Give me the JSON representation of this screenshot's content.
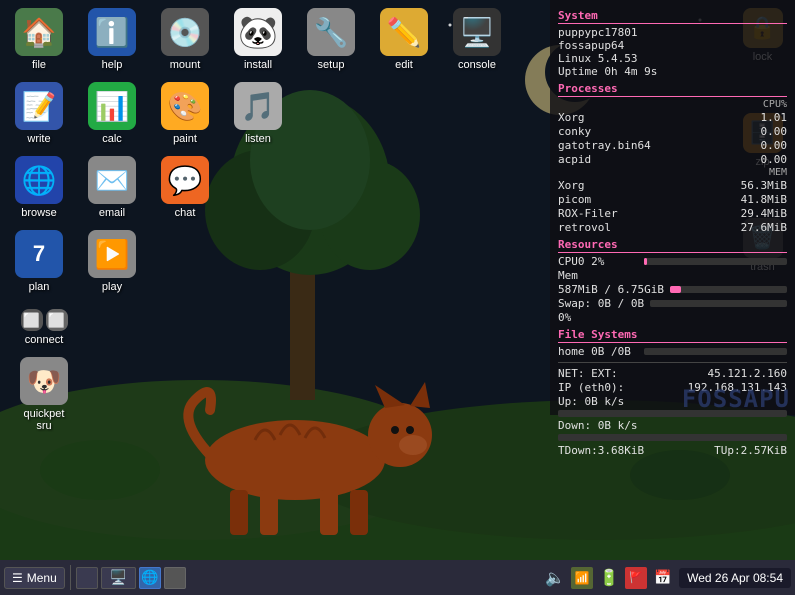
{
  "desktop": {
    "icons": [
      [
        {
          "id": "file",
          "label": "file",
          "emoji": "🏠",
          "color": "#4a7a4a"
        },
        {
          "id": "help",
          "label": "help",
          "emoji": "ℹ️",
          "color": "#2255aa"
        },
        {
          "id": "mount",
          "label": "mount",
          "emoji": "💿",
          "color": "#555555"
        },
        {
          "id": "install",
          "label": "install",
          "emoji": "🐼",
          "color": "#eeeeee"
        },
        {
          "id": "setup",
          "label": "setup",
          "emoji": "🔧",
          "color": "#888888"
        },
        {
          "id": "edit",
          "label": "edit",
          "emoji": "✏️",
          "color": "#ddaa33"
        },
        {
          "id": "console",
          "label": "console",
          "emoji": "🖥️",
          "color": "#333333"
        }
      ],
      [
        {
          "id": "write",
          "label": "write",
          "emoji": "📝",
          "color": "#3355aa"
        },
        {
          "id": "calc",
          "label": "calc",
          "emoji": "📊",
          "color": "#22aa44"
        },
        {
          "id": "paint",
          "label": "paint",
          "emoji": "🎨",
          "color": "#ffaa22"
        },
        {
          "id": "listen",
          "label": "listen",
          "emoji": "🎵",
          "color": "#aaaaaa"
        }
      ],
      [
        {
          "id": "browse",
          "label": "browse",
          "emoji": "🌐",
          "color": "#2244aa"
        },
        {
          "id": "email",
          "label": "email",
          "emoji": "✉️",
          "color": "#888888"
        },
        {
          "id": "chat",
          "label": "chat",
          "emoji": "💬",
          "color": "#ee6622"
        }
      ],
      [
        {
          "id": "plan",
          "label": "plan",
          "emoji": "📅",
          "color": "#2255aa"
        },
        {
          "id": "play",
          "label": "play",
          "emoji": "▶️",
          "color": "#888888"
        }
      ],
      [
        {
          "id": "connect",
          "label": "connect",
          "emoji": "🔌",
          "color": "#555555"
        }
      ],
      [
        {
          "id": "quickpet",
          "label": "quickpet\nsru",
          "emoji": "🐶",
          "color": "#888888"
        }
      ]
    ]
  },
  "sysmon": {
    "section_system": "System",
    "hostname": "puppypc17801",
    "distro": "fossapup64",
    "kernel": "Linux 5.4.53",
    "uptime": "Uptime 0h 4m 9s",
    "section_processes": "Processes",
    "cpu_header": "CPU%",
    "processes": [
      {
        "name": "Xorg",
        "cpu": "1.01"
      },
      {
        "name": "conky",
        "cpu": "0.00"
      },
      {
        "name": "gatotray.bin64",
        "cpu": "0.00"
      },
      {
        "name": "acpid",
        "cpu": "0.00"
      }
    ],
    "mem_header": "MEM",
    "processes_mem": [
      {
        "name": "Xorg",
        "mem": "56.3MiB"
      },
      {
        "name": "picom",
        "mem": "41.8MiB"
      },
      {
        "name": "ROX-Filer",
        "mem": "29.4MiB"
      },
      {
        "name": "retrovol",
        "mem": "27.6MiB"
      }
    ],
    "section_resources": "Resources",
    "cpu0_label": "CPU0 2%",
    "cpu0_pct": 2,
    "mem_label": "Mem",
    "mem_value": "587MiB / 6.75GiB",
    "mem_pct": 9,
    "swap_label": "Swap: 0B  / 0B",
    "swap_pct": 0,
    "swap_pct2": "0%",
    "section_filesystems": "File Systems",
    "home_label": "home 0B  /0B",
    "home_pct": 0,
    "section_net": "",
    "net_ext_label": "NET: EXT:",
    "net_ext_ip": "45.121.2.160",
    "ip_eth0_label": "IP (eth0):",
    "ip_eth0_val": "192.168.131.143",
    "up_label": "Up: 0B  k/s",
    "down_label": "Down: 0B  k/s",
    "tdown": "TDown:3.68KiB",
    "tup": "TUp:2.57KiB"
  },
  "right_icons": {
    "lock_emoji": "🔒",
    "lock_label": "lock",
    "zip_emoji": "🗄️",
    "zip_label": "zip",
    "trash_emoji": "🗑️",
    "trash_label": "trash"
  },
  "taskbar": {
    "menu_label": "☰ Menu",
    "clock": "Wed 26 Apr 08:54"
  }
}
